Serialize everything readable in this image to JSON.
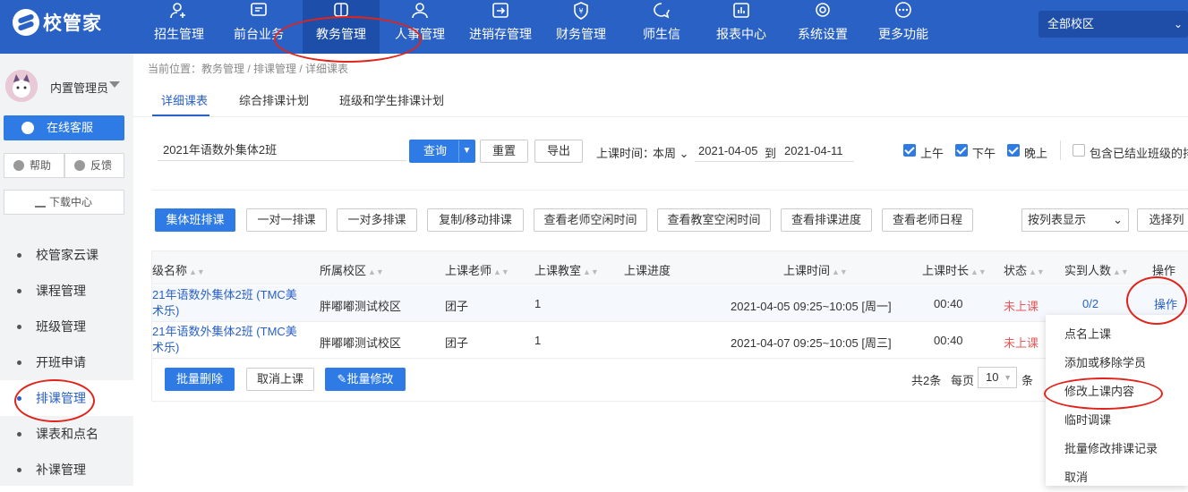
{
  "logo": {
    "text": "校管家"
  },
  "nav": [
    {
      "label": "招生管理",
      "icon": "user-plus-icon"
    },
    {
      "label": "前台业务",
      "icon": "screen-icon"
    },
    {
      "label": "教务管理",
      "icon": "square-icon"
    },
    {
      "label": "人事管理",
      "icon": "person-icon"
    },
    {
      "label": "进销存管理",
      "icon": "arrow-box-icon"
    },
    {
      "label": "财务管理",
      "icon": "money-shield-icon"
    },
    {
      "label": "师生信",
      "icon": "chat-icon"
    },
    {
      "label": "报表中心",
      "icon": "bar-chart-icon"
    },
    {
      "label": "系统设置",
      "icon": "gear-icon"
    },
    {
      "label": "更多功能",
      "icon": "more-dots-icon"
    }
  ],
  "campus": {
    "label": "全部校区"
  },
  "user": {
    "name": "内置管理员"
  },
  "sidebar": {
    "kefu": "在线客服",
    "help": "帮助",
    "feedback": "反馈",
    "download": "下载中心",
    "items": [
      "校管家云课",
      "课程管理",
      "班级管理",
      "开班申请",
      "排课管理",
      "课表和点名",
      "补课管理"
    ]
  },
  "breadcrumb": "当前位置：教务管理 / 排课管理 / 详细课表",
  "tabs": [
    "详细课表",
    "综合排课计划",
    "班级和学生排课计划"
  ],
  "filter": {
    "class_value": "2021年语数外集体2班",
    "query": "查询",
    "reset": "重置",
    "export": "导出",
    "time_label": "上课时间：",
    "week": "本周",
    "date_from": "2021-04-05",
    "to": "到",
    "date_to": "2021-04-11",
    "am": "上午",
    "pm": "下午",
    "night": "晚上",
    "include_graduated": "包含已结业班级的排"
  },
  "actions": [
    "集体班排课",
    "一对一排课",
    "一对多排课",
    "复制/移动排课",
    "查看老师空闲时间",
    "查看教室空闲时间",
    "查看排课进度",
    "查看老师日程"
  ],
  "view_select": "按列表显示",
  "select_columns": "选择列",
  "table": {
    "headers": [
      "级名称",
      "所属校区",
      "上课老师",
      "上课教室",
      "上课进度",
      "上课时间",
      "上课时长",
      "状态",
      "实到人数",
      "操作"
    ],
    "rows": [
      {
        "name": "21年语数外集体2班 (TMC美术乐)",
        "campus": "胖嘟嘟测试校区",
        "teacher": "团子",
        "room": "1",
        "time": "2021-04-05 09:25~10:05 [周一]",
        "duration": "00:40",
        "status": "未上课",
        "attend": "0/2",
        "op": "操作"
      },
      {
        "name": "21年语数外集体2班 (TMC美术乐)",
        "campus": "胖嘟嘟测试校区",
        "teacher": "团子",
        "room": "1",
        "time": "2021-04-07 09:25~10:05 [周三]",
        "duration": "00:40",
        "status": "未上课",
        "attend": "",
        "op": ""
      }
    ]
  },
  "bulk": {
    "delete": "批量删除",
    "cancel": "取消上课",
    "edit": "批量修改"
  },
  "pager": {
    "total": "共2条",
    "per_page": "每页",
    "size": "10",
    "unit": "条"
  },
  "dropdown": [
    "点名上课",
    "添加或移除学员",
    "修改上课内容",
    "临时调课",
    "批量修改排课记录",
    "取消"
  ],
  "colors": {
    "nav": "#2a61c4",
    "primary": "#2f7be5",
    "annotation": "#e0241b",
    "status_red": "#e55a5a"
  }
}
